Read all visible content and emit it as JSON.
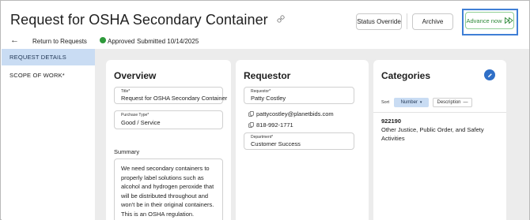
{
  "header": {
    "title": "Request for OSHA Secondary Container",
    "status_override_label": "Status Override",
    "archive_label": "Archive",
    "advance_label": "Advance now"
  },
  "subheader": {
    "back_label": "Return to Requests",
    "status": "Approved",
    "submitted": "Submitted 10/14/2025"
  },
  "sidebar": {
    "items": [
      {
        "label": "REQUEST DETAILS",
        "active": true
      },
      {
        "label": "SCOPE OF WORK*",
        "active": false
      }
    ]
  },
  "overview": {
    "heading": "Overview",
    "title_label": "Title*",
    "title_value": "Request for OSHA Secondary Container",
    "purchase_type_label": "Purchase Type*",
    "purchase_type_value": "Good / Service",
    "summary_label": "Summary",
    "summary_value": "We need secondary containers to properly label solutions such as alcohol and hydrogen peroxide that will be distributed throughout and won't be in their original containers. This is an OSHA regulation."
  },
  "requestor": {
    "heading": "Requestor",
    "requestor_label": "Requestor*",
    "requestor_value": "Patty Costley",
    "email": "pattycostley@planetbids.com",
    "phone": "818-992-1771",
    "department_label": "Department*",
    "department_value": "Customer Success"
  },
  "categories": {
    "heading": "Categories",
    "sort_label": "Sort",
    "sort_number_label": "Number",
    "sort_description_label": "Description",
    "items": [
      {
        "code": "922190",
        "description": "Other Justice, Public Order, and Safety Activities"
      }
    ]
  },
  "colors": {
    "accent": "#2f6fc7",
    "approved": "#2e9a3b",
    "advance": "#2f8a3a",
    "highlight": "#3f7fd6",
    "sidebar_active": "#c9dcf3"
  }
}
